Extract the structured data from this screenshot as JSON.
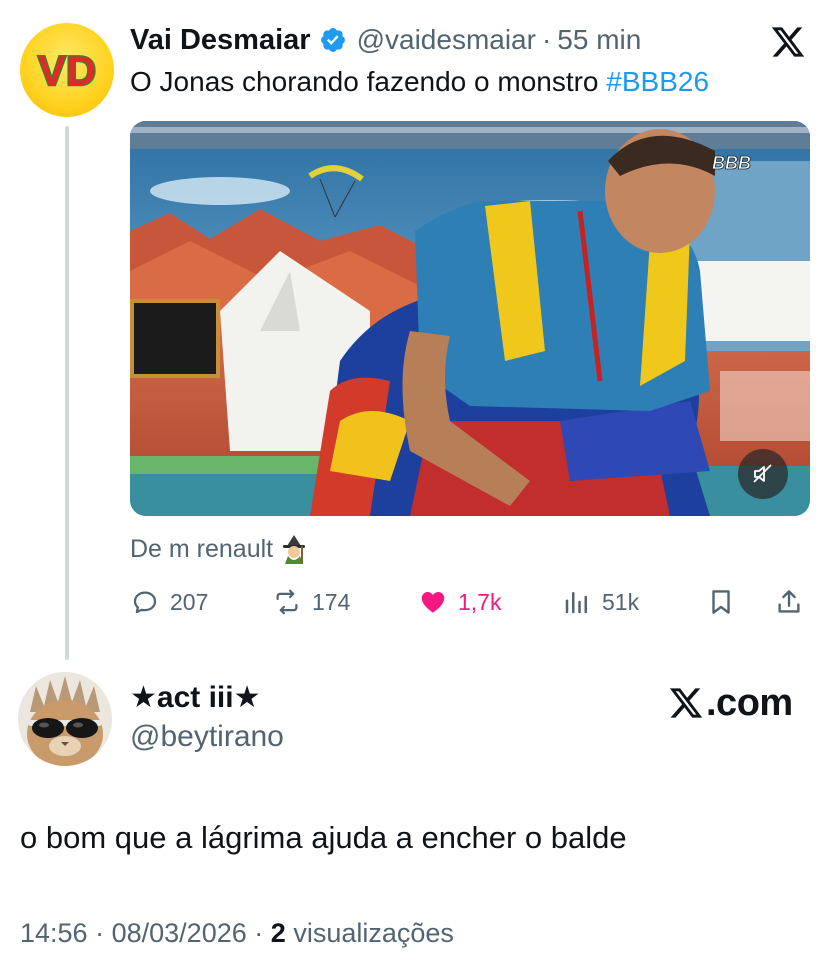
{
  "quoted_tweet": {
    "avatar_text": "VD",
    "author_name": "Vai Desmaiar",
    "handle": "@vaidesmaiar",
    "separator": "·",
    "time": "55 min",
    "text": "O Jonas chorando fazendo o monstro",
    "hashtag": "#BBB26",
    "media_watermark": "BBB",
    "media_source": "De m renault",
    "actions": {
      "replies": "207",
      "reposts": "174",
      "likes": "1,7k",
      "views": "51k"
    }
  },
  "reply": {
    "display_name": "★act iii★",
    "handle": "@beytirano",
    "brand": ".com",
    "text": "o bom que a lágrima ajuda a encher o balde",
    "time": "14:56",
    "separator": "·",
    "date": "08/03/2026",
    "separator2": "·",
    "views_count": "2",
    "views_label": "visualizações"
  },
  "colors": {
    "accent": "#1d9bf0",
    "like": "#f91880",
    "muted": "#536471",
    "text": "#0f1419"
  }
}
